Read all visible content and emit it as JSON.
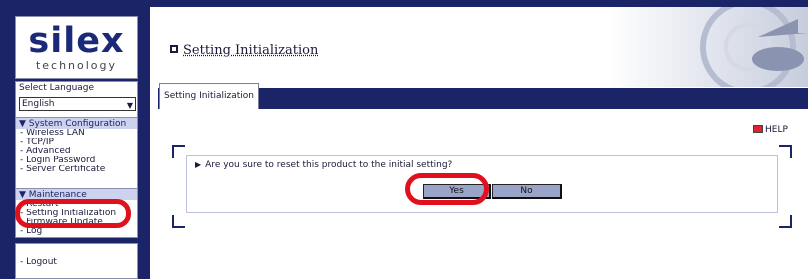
{
  "logo": {
    "main": "silex",
    "sub": "technology"
  },
  "sidebar": {
    "language": {
      "label": "Select Language",
      "selected": "English"
    },
    "system_config": {
      "heading": "▼ System Configuration",
      "items": [
        "- Wireless LAN",
        "- TCP/IP",
        "- Advanced",
        "- Login Password",
        "- Server Certificate"
      ]
    },
    "maintenance": {
      "heading": "▼ Maintenance",
      "items": [
        "- Restart",
        "- Setting Initialization",
        "- Firmware Update",
        "- Log"
      ]
    },
    "logout": "- Logout"
  },
  "page": {
    "title": "Setting Initialization",
    "tab": "Setting Initialization",
    "help": "HELP",
    "question": "Are you sure to reset this product to the initial setting?",
    "yes": "Yes",
    "no": "No"
  },
  "colors": {
    "navy": "#1a2466",
    "highlight": "#e0101d",
    "button": "#9aa3c8"
  }
}
